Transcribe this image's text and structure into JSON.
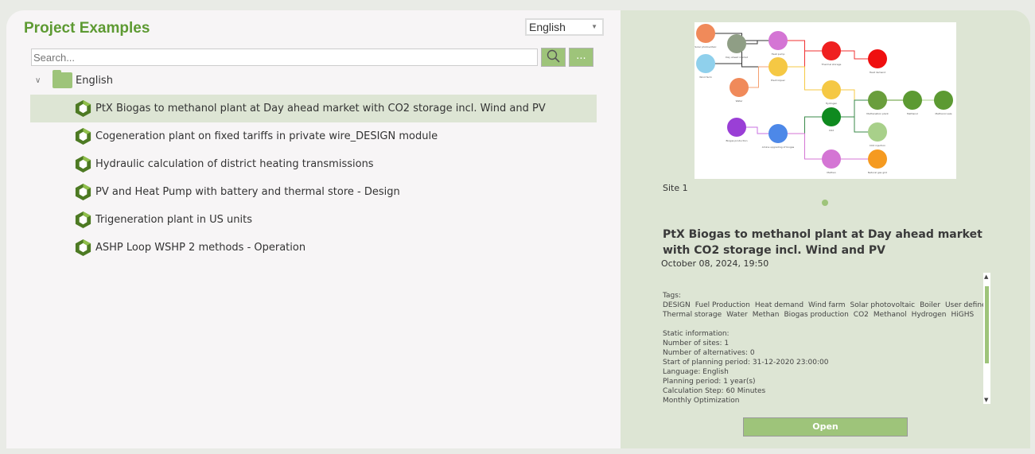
{
  "header": {
    "title": "Project Examples",
    "language": "English"
  },
  "search": {
    "placeholder": "Search...",
    "search_icon": "magnifier-icon",
    "more_label": "..."
  },
  "tree": {
    "folder": "English",
    "items": [
      "PtX Biogas to methanol plant at Day ahead market with CO2 storage incl. Wind and PV",
      "Cogeneration plant on fixed tariffs in private wire_DESIGN module",
      "Hydraulic calculation of district heating transmissions",
      "PV and Heat Pump with battery and thermal store - Design",
      "Trigeneration plant in US units",
      "ASHP Loop WSHP 2 methods - Operation"
    ]
  },
  "preview": {
    "site_label": "Site 1",
    "diagram_nodes": [
      "Solar photovoltaic",
      "Day ahead market",
      "Wind farm",
      "Heat pump",
      "Electrolyser",
      "Water",
      "Thermal storage",
      "Heat demand",
      "Hydrogen",
      "Methanation plant",
      "Methanol",
      "Methanol sale",
      "CO2",
      "CO2 injection",
      "Biogas production",
      "Amine upgrading of biogas",
      "Methan",
      "Natural gas grid"
    ],
    "title": "PtX Biogas to methanol plant at Day ahead market with CO2 storage incl. Wind and PV",
    "date": "October 08, 2024, 19:50",
    "tags_label": "Tags:",
    "tags": [
      "DESIGN",
      "Fuel Production",
      "Heat demand",
      "Wind farm",
      "Solar photovoltaic",
      "Boiler",
      "User defined",
      "Thermal storage",
      "Water",
      "Methan",
      "Biogas production",
      "CO2",
      "Methanol",
      "Hydrogen",
      "HiGHS"
    ],
    "static_label": "Static information:",
    "static": [
      "Number of sites: 1",
      "Number of alternatives: 0",
      "Start of planning period: 31-12-2020 23:00:00",
      "Language: English",
      "Planning period: 1 year(s)",
      "Calculation Step: 60 Minutes",
      "Monthly Optimization"
    ],
    "open_label": "Open"
  },
  "colors": {
    "accent": "#9ec47a",
    "title": "#5d9a32",
    "selected_row": "#dde5d4"
  }
}
